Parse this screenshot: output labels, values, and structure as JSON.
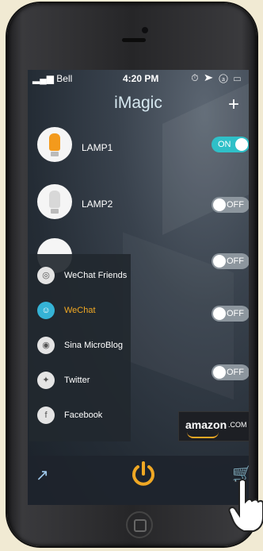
{
  "status": {
    "carrier": "Bell",
    "time": "4:20 PM",
    "icons": "⏱ ➤ ⓐ ▭"
  },
  "header": {
    "title": "iMagic",
    "add_label": "+"
  },
  "lamps": [
    {
      "name": "LAMP1",
      "state": "ON",
      "bulb_color": "#f39a1c"
    },
    {
      "name": "LAMP2",
      "state": "OFF",
      "bulb_color": "#e8e8e8"
    },
    {
      "name": "",
      "state": "OFF",
      "bulb_color": "#e8e8e8"
    },
    {
      "name": "",
      "state": "OFF",
      "bulb_color": "#e8e8e8"
    },
    {
      "name": "",
      "state": "OFF",
      "bulb_color": "#e8e8e8"
    }
  ],
  "share_menu": {
    "items": [
      {
        "label": "WeChat Friends",
        "icon": "wechat-moments-icon",
        "glyph": "◎"
      },
      {
        "label": "WeChat",
        "icon": "wechat-icon",
        "glyph": "☺",
        "active": true
      },
      {
        "label": "Sina MicroBlog",
        "icon": "weibo-icon",
        "glyph": "◉"
      },
      {
        "label": "Twitter",
        "icon": "twitter-icon",
        "glyph": "✦"
      },
      {
        "label": "Facebook",
        "icon": "facebook-icon",
        "glyph": "f"
      }
    ]
  },
  "amazon": {
    "word": "amazon",
    "suffix": ".COM"
  },
  "bottom": {
    "share_glyph": "↗",
    "cart_glyph": "🛒"
  },
  "colors": {
    "accent_on": "#2fc0c8",
    "accent_orange": "#f0a824",
    "toggle_off": "#8d969e"
  }
}
